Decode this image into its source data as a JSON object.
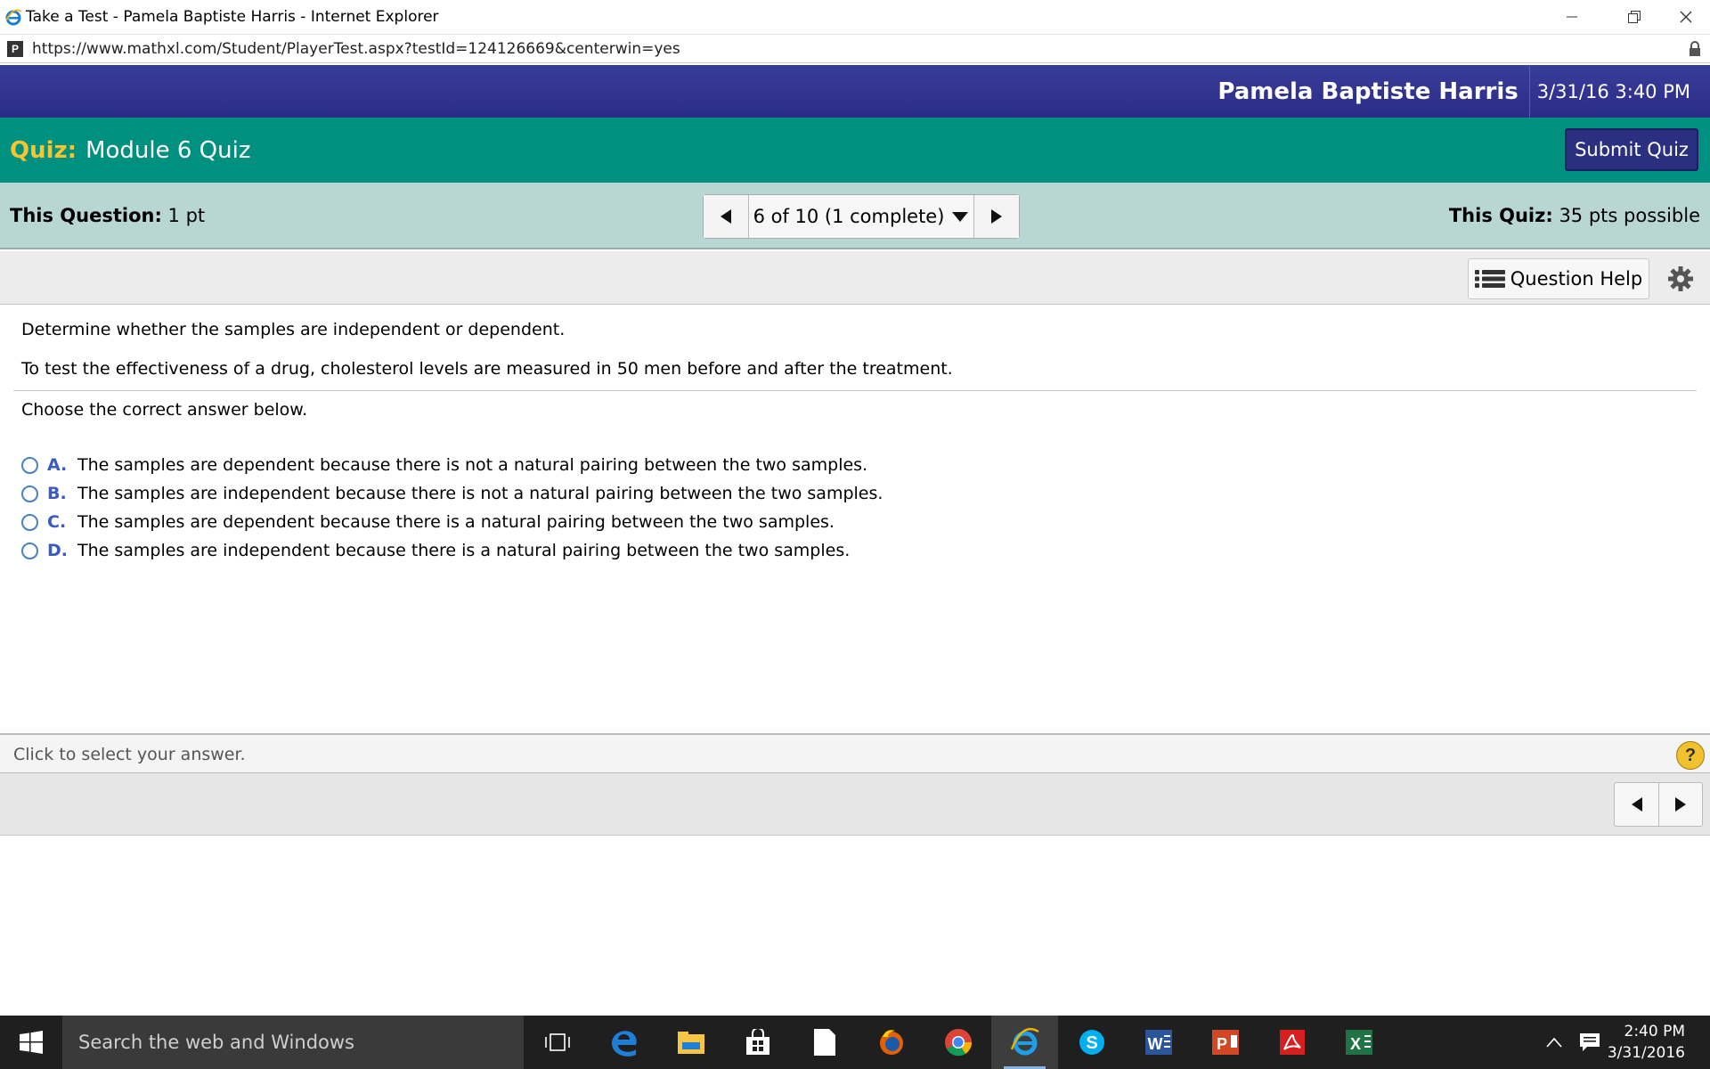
{
  "window": {
    "title": "Take a Test - Pamela Baptiste Harris - Internet Explorer",
    "url": "https://www.mathxl.com/Student/PlayerTest.aspx?testId=124126669&centerwin=yes"
  },
  "header": {
    "user_name": "Pamela Baptiste Harris",
    "datetime": "3/31/16 3:40 PM"
  },
  "quiz": {
    "label": "Quiz:",
    "name": "Module 6 Quiz",
    "submit_label": "Submit Quiz"
  },
  "info": {
    "question_label": "This Question:",
    "question_points": "1 pt",
    "nav_status": "6 of 10 (1 complete)",
    "quiz_label": "This Quiz:",
    "quiz_points": "35 pts possible"
  },
  "toolbar": {
    "help_label": "Question Help"
  },
  "question": {
    "instruction": "Determine whether the samples are independent or dependent.",
    "prompt": "To test the effectiveness of a drug, cholesterol levels are measured in 50 men before and after the treatment.",
    "choose": "Choose the correct answer below.",
    "options": [
      {
        "letter": "A.",
        "text": "The samples are dependent because there is not a natural pairing between the two samples."
      },
      {
        "letter": "B.",
        "text": "The samples are independent because there is not a natural pairing between the two samples."
      },
      {
        "letter": "C.",
        "text": "The samples are dependent because there is a natural pairing between the two samples."
      },
      {
        "letter": "D.",
        "text": "The samples are independent because there is a natural pairing between the two samples."
      }
    ]
  },
  "status": {
    "hint": "Click to select your answer.",
    "help_symbol": "?"
  },
  "taskbar": {
    "search_placeholder": "Search the web and Windows",
    "time": "2:40 PM",
    "date": "3/31/2016",
    "icons": [
      "task-view-icon",
      "edge-icon",
      "file-explorer-icon",
      "store-icon",
      "document-icon",
      "firefox-icon",
      "chrome-icon",
      "internet-explorer-icon",
      "skype-icon",
      "word-icon",
      "powerpoint-icon",
      "acrobat-icon",
      "excel-icon"
    ]
  },
  "colors": {
    "header_blue": "#2f3290",
    "quiz_teal": "#00907f",
    "info_bar": "#b8d7d4",
    "quiz_label_yellow": "#f7c531",
    "option_letter": "#3a5bbf"
  }
}
